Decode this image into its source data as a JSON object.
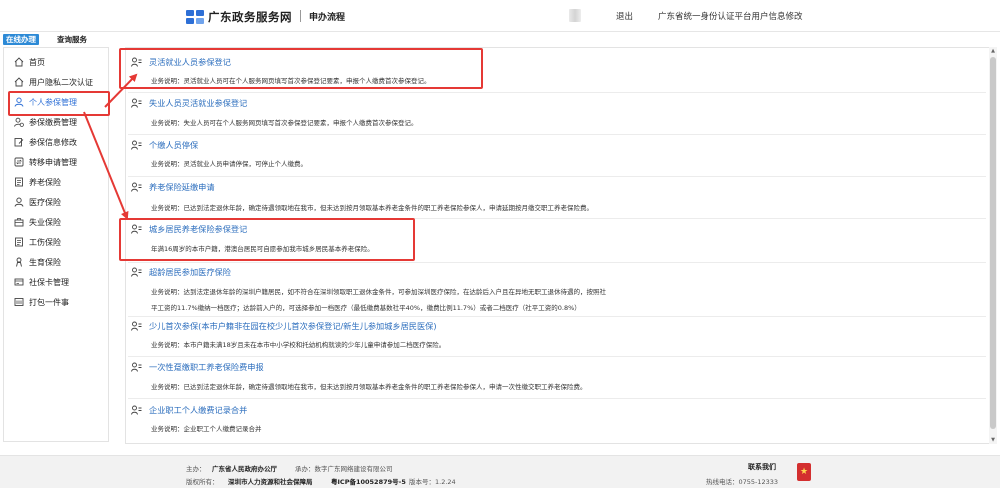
{
  "header": {
    "brand": "广东政务服务网",
    "section": "申办流程",
    "exit": "退出",
    "account_link": "广东省统一身份认证平台用户信息修改"
  },
  "tabs": [
    "在线办理",
    "查询服务"
  ],
  "sidebar": {
    "items": [
      {
        "label": "首页",
        "icon": "home-icon"
      },
      {
        "label": "用户隐私二次认证",
        "icon": "home-icon"
      },
      {
        "label": "个人参保管理",
        "icon": "user-icon"
      },
      {
        "label": "参保缴费管理",
        "icon": "user-coin-icon"
      },
      {
        "label": "参保信息修改",
        "icon": "edit-icon"
      },
      {
        "label": "转移申请管理",
        "icon": "transfer-icon"
      },
      {
        "label": "养老保险",
        "icon": "document-icon"
      },
      {
        "label": "医疗保险",
        "icon": "user-icon"
      },
      {
        "label": "失业保险",
        "icon": "briefcase-icon"
      },
      {
        "label": "工伤保险",
        "icon": "document-icon"
      },
      {
        "label": "生育保险",
        "icon": "baby-icon"
      },
      {
        "label": "社保卡管理",
        "icon": "card-icon"
      },
      {
        "label": "打包一件事",
        "icon": "package-icon"
      }
    ],
    "active_index": 2
  },
  "services": [
    {
      "title": "灵活就业人员参保登记",
      "desc": [
        "业务说明：灵活就业人员可在个人服务网页填写首次参保登记要素，申报个人缴费首次参保登记。"
      ]
    },
    {
      "title": "失业人员灵活就业参保登记",
      "desc": [
        "业务说明：失业人员可在个人服务网页填写首次参保登记要素，申报个人缴费首次参保登记。"
      ]
    },
    {
      "title": "个缴人员停保",
      "desc": [
        "业务说明：灵活就业人员申请停保，可停止个人缴费。"
      ]
    },
    {
      "title": "养老保险延缴申请",
      "desc": [
        "业务说明：已达到法定退休年龄，确定待遇领取地在我市，但未达到按月领取基本养老金条件的职工养老保险参保人，申请延期按月缴交职工养老保险费。"
      ]
    },
    {
      "title": "城乡居民养老保险参保登记",
      "desc": [
        "年满16周岁的本市户籍，港澳台居民可自愿参加我市城乡居民基本养老保险。"
      ]
    },
    {
      "title": "超龄居民参加医疗保险",
      "desc": [
        "业务说明：达到法定退休年龄的深圳户籍居民，如不符合在深圳领取职工退休金条件，可参加深圳医疗保险，在达龄后入户且在异地无职工退休待遇的，按照社",
        "平工资的11.7%缴纳一档医疗；达龄前入户的，可选择参加一档医疗（最低缴费基数社平40%，缴费比例11.7%）或者二档医疗（社平工资的0.8%）"
      ]
    },
    {
      "title": "少儿首次参保(本市户籍非在园在校少儿首次参保登记/新生儿参加城乡居民医保)",
      "desc": [
        "业务说明：本市户籍未满18岁且未在本市中小学校和托幼机构就读的少年儿童申请参加二档医疗保险。"
      ]
    },
    {
      "title": "一次性趸缴职工养老保险费申报",
      "desc": [
        "业务说明：已达到法定退休年龄，确定待遇领取地在我市，但未达到按月领取基本养老金条件的职工养老保险参保人，申请一次性缴交职工养老保险费。"
      ]
    },
    {
      "title": "企业职工个人缴费记录合并",
      "desc": [
        "业务说明：企业职工个人缴费记录合并"
      ]
    }
  ],
  "footer": {
    "sponsor_label": "主办：",
    "sponsor": "广东省人民政府办公厅",
    "undertaker": "承办：数字广东网络建设有限公司",
    "copyright_label": "版权所有：",
    "copyright": "深圳市人力资源和社会保障局",
    "icp": "粤ICP备10052879号-5",
    "version": "版本号：1.2.24",
    "contact": "联系我们",
    "hotline": "热线电话：0755-12333"
  },
  "colors": {
    "accent": "#2d6fd6",
    "link": "#2b6dbd",
    "highlight": "#e53935",
    "tab": "#2d8ad6"
  }
}
